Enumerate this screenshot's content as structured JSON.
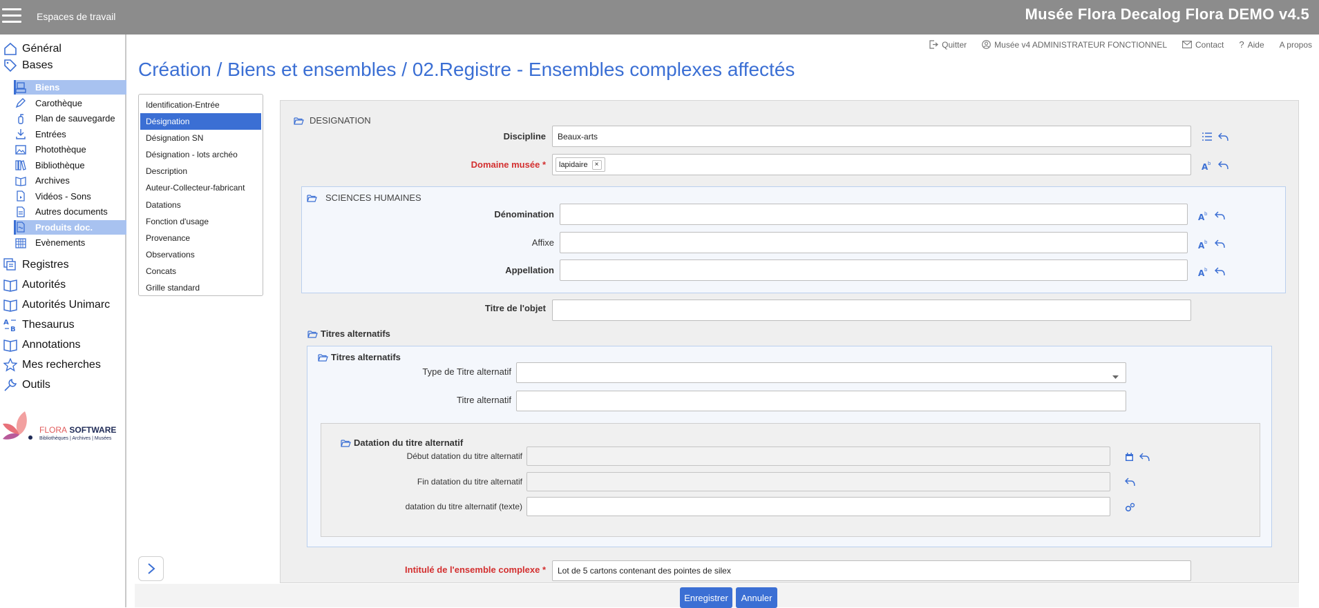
{
  "topbar": {
    "workspace_label": "Espaces de travail",
    "app_title": "Musée Flora Decalog Flora DEMO v4.5"
  },
  "sidebar": {
    "top_items": [
      {
        "label": "Général",
        "icon": "home-icon"
      },
      {
        "label": "Bases",
        "icon": "tag-icon"
      },
      {
        "label": "Registres",
        "icon": "registers-icon"
      },
      {
        "label": "Autorités",
        "icon": "book-icon"
      },
      {
        "label": "Autorités Unimarc",
        "icon": "book-icon"
      },
      {
        "label": "Thesaurus",
        "icon": "thesaurus-icon"
      },
      {
        "label": "Annotations",
        "icon": "book-icon"
      },
      {
        "label": "Mes recherches",
        "icon": "star-icon"
      },
      {
        "label": "Outils",
        "icon": "wrench-icon"
      }
    ],
    "sub_items": [
      {
        "label": "Biens",
        "icon": "biens-icon",
        "active": true
      },
      {
        "label": "Carothèque",
        "icon": "pen-icon",
        "active": false
      },
      {
        "label": "Plan de sauvegarde",
        "icon": "extinguisher-icon",
        "active": false
      },
      {
        "label": "Entrées",
        "icon": "download-icon",
        "active": false
      },
      {
        "label": "Photothèque",
        "icon": "image-icon",
        "active": false
      },
      {
        "label": "Bibliothèque",
        "icon": "books-icon",
        "active": false
      },
      {
        "label": "Archives",
        "icon": "archive-icon",
        "active": false
      },
      {
        "label": "Vidéos - Sons",
        "icon": "media-file-icon",
        "active": false
      },
      {
        "label": "Autres documents",
        "icon": "document-icon",
        "active": false
      },
      {
        "label": "Produits doc.",
        "icon": "doc-products-icon",
        "active": true
      },
      {
        "label": "Evènements",
        "icon": "calendar-icon",
        "active": false
      }
    ],
    "logo": {
      "brand_a": "FLORA",
      "brand_b": "SOFTWARE",
      "tagline": "Bibliothèques | Archives | Musées"
    }
  },
  "header_links": [
    {
      "label": "Quitter",
      "icon": "logout-icon"
    },
    {
      "label": "Musée v4 ADMINISTRATEUR FONCTIONNEL",
      "icon": "user-icon"
    },
    {
      "label": "Contact",
      "icon": "mail-icon"
    },
    {
      "label": "Aide",
      "icon": "help-icon"
    },
    {
      "label": "A propos",
      "icon": ""
    }
  ],
  "page_title": "Création / Biens et ensembles / 02.Registre - Ensembles complexes affectés",
  "tabs": [
    {
      "label": "Identification-Entrée",
      "active": false
    },
    {
      "label": "Désignation",
      "active": true
    },
    {
      "label": "Désignation SN",
      "active": false
    },
    {
      "label": "Désignation - lots archéo",
      "active": false
    },
    {
      "label": "Description",
      "active": false
    },
    {
      "label": "Auteur-Collecteur-fabricant",
      "active": false
    },
    {
      "label": "Datations",
      "active": false
    },
    {
      "label": "Fonction d'usage",
      "active": false
    },
    {
      "label": "Provenance",
      "active": false
    },
    {
      "label": "Observations",
      "active": false
    },
    {
      "label": "Concats",
      "active": false
    },
    {
      "label": "Grille standard",
      "active": false
    }
  ],
  "form": {
    "designation": {
      "title": "DESIGNATION",
      "discipline_label": "Discipline",
      "discipline_value": "Beaux-arts",
      "domaine_label": "Domaine musée",
      "required_mark": "*",
      "domaine_chip": "lapidaire",
      "chip_remove": "×"
    },
    "sciences": {
      "title": "SCIENCES HUMAINES",
      "denomination_label": "Dénomination",
      "affixe_label": "Affixe",
      "appellation_label": "Appellation"
    },
    "titre_objet_label": "Titre de l'objet",
    "titres_alt": {
      "title": "Titres alternatifs",
      "inner_title": "Titres alternatifs",
      "type_label": "Type de Titre alternatif",
      "titre_label": "Titre alternatif"
    },
    "datation": {
      "title": "Datation du titre alternatif",
      "debut_label": "Début datation du titre alternatif",
      "fin_label": "Fin datation du titre alternatif",
      "texte_label": "datation du titre alternatif (texte)"
    },
    "intitule_label": "Intitulé de l'ensemble complexe",
    "intitule_value": "Lot de 5 cartons contenant des pointes de silex"
  },
  "buttons": {
    "save": "Enregistrer",
    "cancel": "Annuler"
  },
  "colors": {
    "accent": "#3b6fd4",
    "required": "#d32f2f",
    "topbar": "#8c8c8c"
  }
}
